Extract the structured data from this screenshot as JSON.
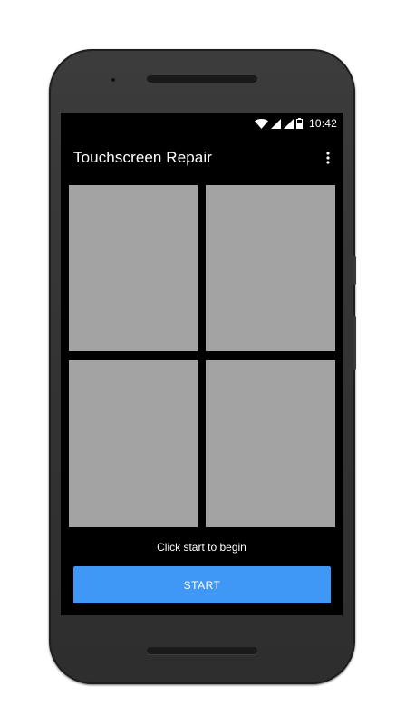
{
  "status_bar": {
    "time": "10:42",
    "icons": [
      "wifi-icon",
      "signal-icon",
      "signal-icon",
      "battery-icon"
    ]
  },
  "app_bar": {
    "title": "Touchscreen Repair",
    "overflow_icon": "more-vert-icon"
  },
  "grid": {
    "tile_color": "#a3a3a3",
    "tiles": 4
  },
  "main": {
    "hint": "Click start to begin",
    "start_label": "START",
    "start_color": "#3f97f6"
  }
}
